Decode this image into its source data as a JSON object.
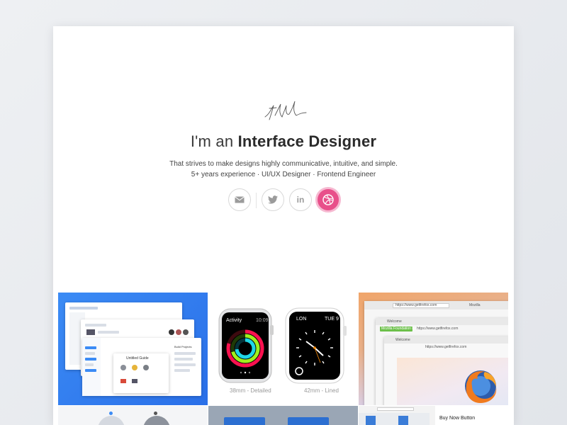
{
  "hero": {
    "headline_prefix": "I'm an ",
    "headline_strong": "Interface Designer",
    "tagline_line1": "That strives to make designs highly communicative, intuitive, and simple.",
    "tagline_line2": "5+ years experience · UI/UX Designer · Frontend Engineer"
  },
  "social": [
    {
      "name": "email",
      "icon": "mail-icon"
    },
    {
      "name": "twitter",
      "icon": "twitter-icon"
    },
    {
      "name": "linkedin",
      "icon": "linkedin-icon",
      "label": "in"
    },
    {
      "name": "dribbble",
      "icon": "dribbble-icon"
    }
  ],
  "colors": {
    "dribbble": "#e8508a",
    "tile_blue": "#2f7df0"
  },
  "portfolio": {
    "watch": {
      "left_title": "Activity",
      "left_time": "10:09",
      "right_city": "LON",
      "right_date": "TUE 9",
      "caption_left": "38mm - Detailed",
      "caption_right": "42mm - Lined"
    },
    "browser": {
      "url_text": "https://www.getfirefox.com",
      "tab_label": "Welcome",
      "tab2_label": "Mozilla",
      "badge_label": "Mozilla Foundation (US)"
    },
    "app": {
      "panel_title": "Build Projects",
      "dialog_title": "Untitled Guide"
    },
    "bottom": {
      "buy_now": "Buy Now Button"
    }
  }
}
